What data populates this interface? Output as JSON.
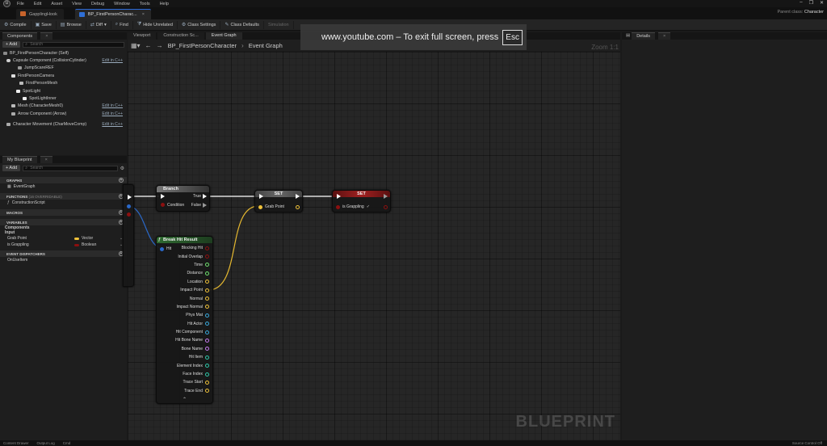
{
  "menu": {
    "items": [
      "File",
      "Edit",
      "Asset",
      "View",
      "Debug",
      "Window",
      "Tools",
      "Help"
    ]
  },
  "tabs": [
    {
      "label": "GapplingHook",
      "active": false
    },
    {
      "label": "BP_FirstPersonCharac...",
      "active": true
    }
  ],
  "parent_class": {
    "label": "Parent class:",
    "value": "Character"
  },
  "toolbar": {
    "compile": "Compile",
    "save": "Save",
    "browse": "Browse",
    "diff": "Diff",
    "find": "Find",
    "hide_unrelated": "Hide Unrelated",
    "class_settings": "Class Settings",
    "class_defaults": "Class Defaults",
    "simulation": "Simulation"
  },
  "components": {
    "tab": "Components",
    "add": "+ Add",
    "search_placeholder": "Search",
    "items": [
      {
        "label": "BP_FirstPersonCharacter (Self)",
        "edit": ""
      },
      {
        "label": "Capsule Component (CollisionCylinder)",
        "edit": "Edit in C++"
      },
      {
        "label": "JumpScareREF",
        "edit": ""
      },
      {
        "label": "FirstPersonCamera",
        "edit": ""
      },
      {
        "label": "FirstPersonMesh",
        "edit": ""
      },
      {
        "label": "SpotLight",
        "edit": ""
      },
      {
        "label": "SpotLightInner",
        "edit": ""
      },
      {
        "label": "Mesh (CharacterMesh0)",
        "edit": "Edit in C++"
      },
      {
        "label": "Arrow Component (Arrow)",
        "edit": "Edit in C++"
      },
      {
        "label": "Character Movement (CharMoveComp)",
        "edit": "Edit in C++"
      }
    ]
  },
  "my_blueprint": {
    "tab": "My Blueprint",
    "add": "+ Add",
    "search_placeholder": "Search",
    "graphs_header": "GRAPHS",
    "event_graph": "EventGraph",
    "functions_header": "FUNCTIONS",
    "functions_overridable": "(16 OVERRIDABLE)",
    "construction_script": "ConstructionScript",
    "macros_header": "MACROS",
    "variables_header": "VARIABLES",
    "components_cat": "Components",
    "input_cat": "Input",
    "variables": [
      {
        "name": "Grab Point",
        "type": "Vector",
        "color": "#f0c23a"
      },
      {
        "name": "is Grappling",
        "type": "Boolean",
        "color": "#8c0f0f"
      }
    ],
    "dispatchers_header": "EVENT DISPATCHERS",
    "dispatcher": "OnUseItem"
  },
  "editor": {
    "tabs": [
      "Viewport",
      "Construction Sc...",
      "Event Graph"
    ],
    "breadcrumb_root": "BP_FirstPersonCharacter",
    "breadcrumb_sep": "›",
    "breadcrumb_leaf": "Event Graph",
    "zoom": "Zoom 1:1",
    "watermark": "BLUEPRINT"
  },
  "overlay": {
    "text": "www.youtube.com – To exit full screen, press",
    "key": "Esc"
  },
  "details": {
    "tab": "Details"
  },
  "nodes": {
    "branch": {
      "title": "Branch",
      "true_label": "True",
      "false_label": "False",
      "condition_label": "Condition"
    },
    "set_grab": {
      "title": "SET",
      "pin": "Grab Point"
    },
    "set_grappling": {
      "title": "SET",
      "pin": "is Grappling"
    },
    "break_hit": {
      "title": "Break Hit Result",
      "hit_label": "Hit",
      "pins": [
        {
          "label": "Blocking Hit",
          "color": "#8c1010"
        },
        {
          "label": "Initial Overlap",
          "color": "#8c1010"
        },
        {
          "label": "Time",
          "color": "#6ee06e"
        },
        {
          "label": "Distance",
          "color": "#6ee06e"
        },
        {
          "label": "Location",
          "color": "#f0c23a"
        },
        {
          "label": "Impact Point",
          "color": "#f0c23a"
        },
        {
          "label": "Normal",
          "color": "#f0c23a"
        },
        {
          "label": "Impact Normal",
          "color": "#f0c23a"
        },
        {
          "label": "Phys Mat",
          "color": "#39a9dc"
        },
        {
          "label": "Hit Actor",
          "color": "#39a9dc"
        },
        {
          "label": "Hit Component",
          "color": "#39a9dc"
        },
        {
          "label": "Hit Bone Name",
          "color": "#c77cf0"
        },
        {
          "label": "Bone Name",
          "color": "#c77cf0"
        },
        {
          "label": "Hit Item",
          "color": "#2ec7a8"
        },
        {
          "label": "Element Index",
          "color": "#2ec7a8"
        },
        {
          "label": "Face Index",
          "color": "#2ec7a8"
        },
        {
          "label": "Trace Start",
          "color": "#f0c23a"
        },
        {
          "label": "Trace End",
          "color": "#f0c23a"
        }
      ]
    }
  },
  "bottom": {
    "items": [
      "Content Drawer",
      "Output Log",
      "Cmd"
    ],
    "right": "Source Control Off"
  }
}
